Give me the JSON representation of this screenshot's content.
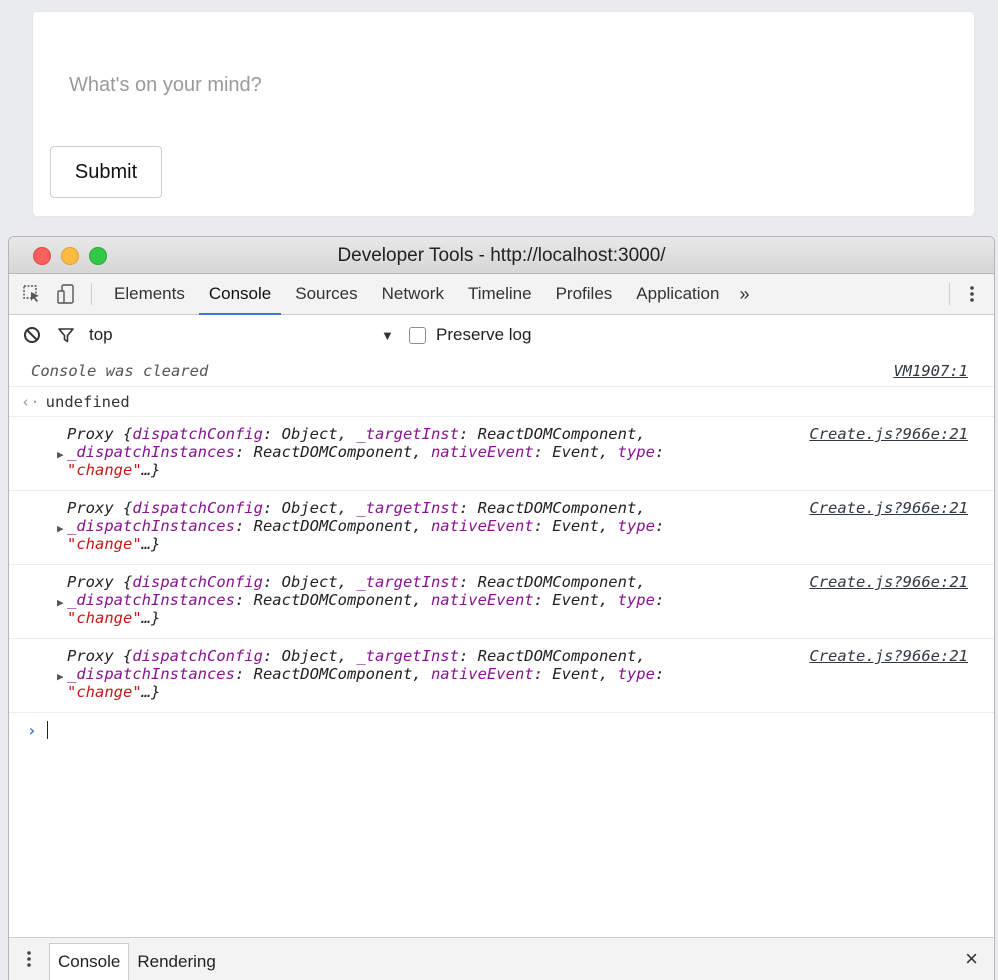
{
  "app": {
    "post_placeholder": "What's on your mind?",
    "submit_label": "Submit"
  },
  "devtools": {
    "window_title": "Developer Tools - http://localhost:3000/",
    "traffic_lights": {
      "close": "#fc605c",
      "minimize": "#fdbc40",
      "zoom": "#34c84a"
    },
    "toolbar_icons": [
      "inspect-element-icon",
      "device-toolbar-icon"
    ],
    "tabs": [
      {
        "label": "Elements"
      },
      {
        "label": "Console",
        "active": true
      },
      {
        "label": "Sources"
      },
      {
        "label": "Network"
      },
      {
        "label": "Timeline"
      },
      {
        "label": "Profiles"
      },
      {
        "label": "Application"
      }
    ],
    "more_tabs": "»",
    "accent_color": "#3879d9",
    "filter_bar": {
      "context": "top",
      "dropdown_arrow": "▼",
      "preserve_log_label": "Preserve log",
      "preserve_log_checked": false
    },
    "console": {
      "cleared": {
        "text": "Console was cleared",
        "source": "VM1907:1"
      },
      "result": {
        "arrow": "‹·",
        "text": "undefined"
      },
      "log_entries": [
        {
          "source": "Create.js?966e:21"
        },
        {
          "source": "Create.js?966e:21"
        },
        {
          "source": "Create.js?966e:21"
        },
        {
          "source": "Create.js?966e:21"
        }
      ],
      "proxy": {
        "prefix": "Proxy {",
        "k1": "dispatchConfig",
        "v1": ": Object, ",
        "k2": "_targetInst",
        "v2": ": ReactDOMComponent,",
        "k3": "_dispatchInstances",
        "v3": ": ReactDOMComponent, ",
        "k4": "nativeEvent",
        "v4": ": Event, ",
        "k5": "type",
        "v5": ":",
        "str": "\"change\"",
        "suffix": "…}"
      },
      "prompt": "›"
    },
    "drawer": {
      "tabs": [
        {
          "label": "Console",
          "active": true
        },
        {
          "label": "Rendering"
        }
      ],
      "close": "×"
    }
  }
}
